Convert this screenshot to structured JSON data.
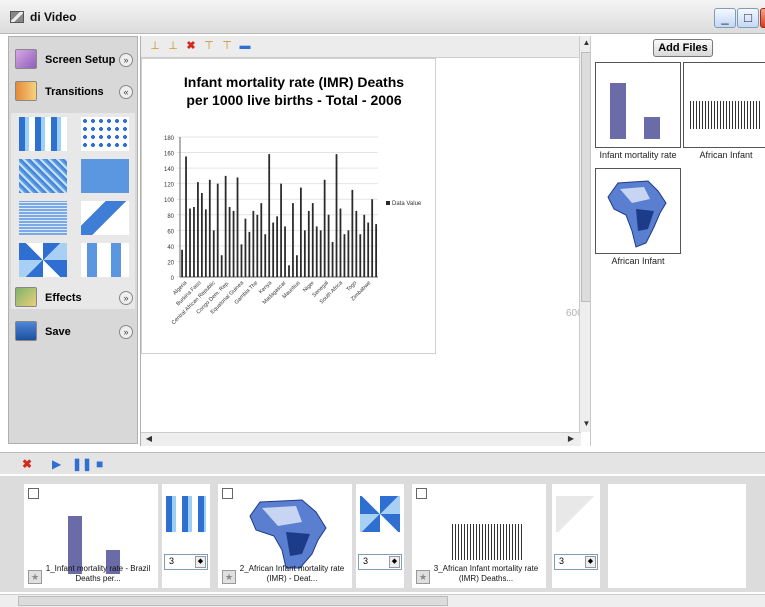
{
  "window": {
    "title": "di Video",
    "minimize_label": "_",
    "maximize_label": "□",
    "close_label": "✕"
  },
  "left_panel": {
    "screen_setup": "Screen Setup",
    "transitions": "Transitions",
    "effects": "Effects",
    "save": "Save",
    "expand_chevron": "»",
    "collapse_chevron": "«"
  },
  "canvas": {
    "size_marker": "600"
  },
  "chart_data": {
    "type": "bar",
    "title": "Infant mortality rate (IMR) Deaths per 1000 live births - Total - 2006",
    "ylim": [
      0,
      180
    ],
    "yticks": [
      0,
      20,
      40,
      60,
      80,
      100,
      120,
      140,
      160,
      180
    ],
    "legend": "Data Value",
    "legend_position": "right",
    "tick_labels": [
      "Algeria",
      "Burkina Faso",
      "Central African Republic",
      "Congo Dem. Rep.",
      "Equatorial Guinea",
      "Gambia The",
      "Kenya",
      "Madagascar",
      "Mauritius",
      "Niger",
      "Senegal",
      "South Africa",
      "Togo",
      "Zimbabwe"
    ],
    "values": [
      35,
      155,
      88,
      90,
      122,
      108,
      87,
      125,
      60,
      120,
      28,
      130,
      90,
      85,
      128,
      42,
      75,
      58,
      85,
      80,
      95,
      55,
      158,
      70,
      78,
      120,
      65,
      15,
      95,
      28,
      115,
      60,
      85,
      95,
      65,
      60,
      125,
      80,
      45,
      158,
      88,
      55,
      60,
      112,
      85,
      55,
      80,
      70,
      100,
      68
    ]
  },
  "right_panel": {
    "add_files": "Add Files",
    "files": [
      {
        "label": "Infant mortality rate"
      },
      {
        "label": "African Infant"
      },
      {
        "label": "African Infant"
      }
    ]
  },
  "timeline": {
    "clips": [
      {
        "caption": "1_Infant mortality rate - Brazil Deaths per..."
      },
      {
        "caption": "2_African Infant mortality rate (IMR) - Deat..."
      },
      {
        "caption": "3_African Infant mortality rate (IMR) Deaths..."
      }
    ],
    "transitions": [
      {
        "duration": "3"
      },
      {
        "duration": "3"
      },
      {
        "duration": "3"
      }
    ]
  },
  "colors": {
    "bar": "#2a2a2a",
    "accent_blue": "#2f6fd2"
  }
}
